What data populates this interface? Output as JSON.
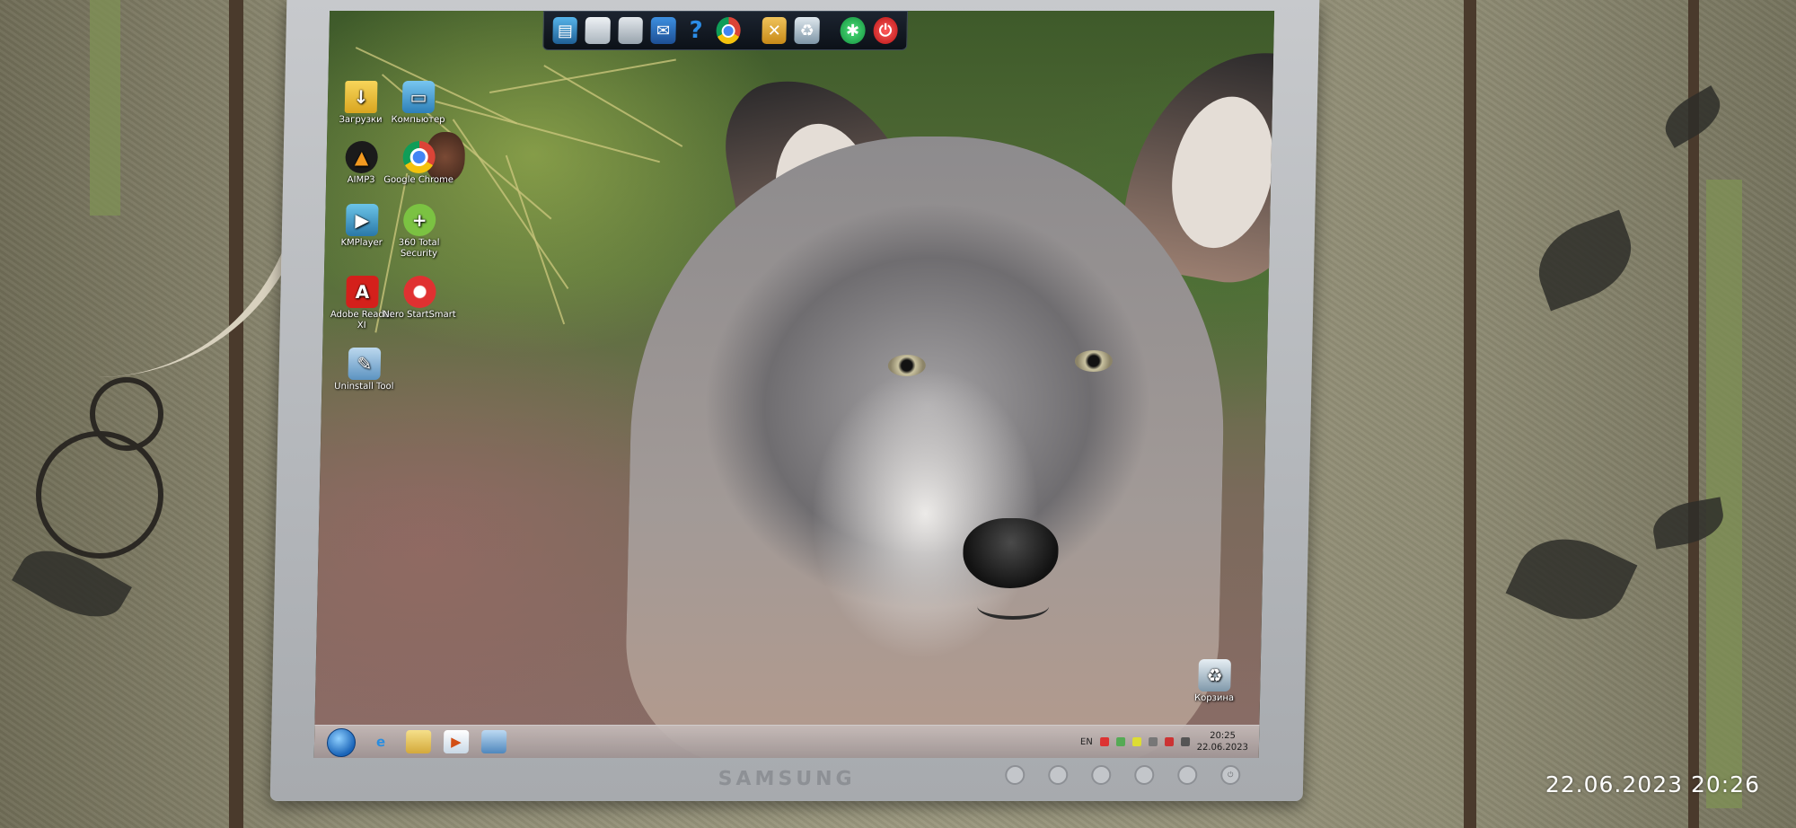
{
  "photo_timestamp": "22.06.2023  20:26",
  "monitor": {
    "brand": "SAMSUNG"
  },
  "dock": {
    "items": [
      {
        "icon": "network-computer-icon"
      },
      {
        "icon": "drive-icon"
      },
      {
        "icon": "drive-icon"
      },
      {
        "icon": "mail-icon"
      },
      {
        "icon": "help-icon",
        "glyph": "?"
      },
      {
        "icon": "chrome-icon"
      },
      {
        "icon": "tools-icon"
      },
      {
        "icon": "recycle-bin-icon"
      },
      {
        "icon": "green-button-icon"
      },
      {
        "icon": "power-icon"
      }
    ]
  },
  "desktop": {
    "icons": [
      {
        "label": "Загрузки",
        "icon": "folder-icon"
      },
      {
        "label": "Компьютер",
        "icon": "computer-icon"
      },
      {
        "label": "AIMP3",
        "icon": "aimp-icon"
      },
      {
        "label": "Google Chrome",
        "icon": "chrome-icon"
      },
      {
        "label": "KMPlayer",
        "icon": "kmplayer-icon"
      },
      {
        "label": "360 Total Security",
        "icon": "360-security-icon"
      },
      {
        "label": "Adobe Reader XI",
        "icon": "adobe-reader-icon"
      },
      {
        "label": "Nero StartSmart",
        "icon": "nero-icon"
      },
      {
        "label": "Uninstall Tool",
        "icon": "uninstall-tool-icon"
      },
      {
        "label": "Корзина",
        "icon": "recycle-bin-icon"
      }
    ]
  },
  "taskbar": {
    "language": "EN",
    "time": "20:25",
    "date": "22.06.2023"
  },
  "colors": {
    "taskbar": "#b4a9a8",
    "dock": "#0c1118",
    "bezel": "#b8bbbf"
  }
}
